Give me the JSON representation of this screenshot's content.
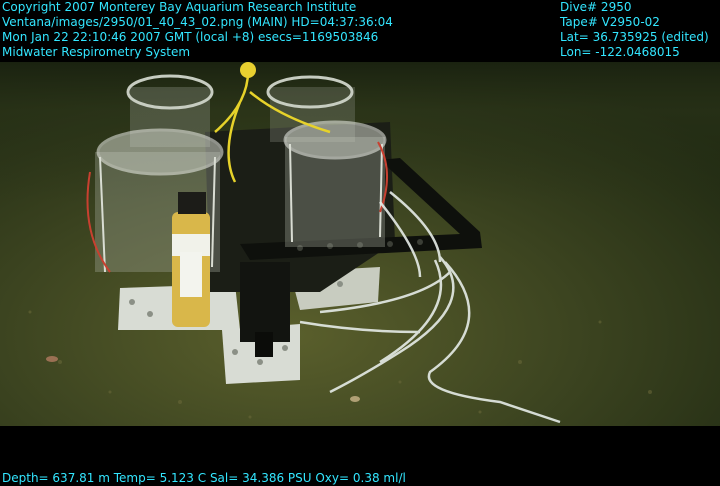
{
  "overlay": {
    "top_left": [
      "Copyright 2007 Monterey Bay Aquarium Research Institute",
      "Ventana/images/2950/01_40_43_02.png (MAIN)  HD=04:37:36:04",
      "Mon Jan 22 22:10:46 2007 GMT (local +8)  esecs=1169503846",
      "Midwater Respirometry System"
    ],
    "top_right": [
      "Dive# 2950",
      "Tape# V2950-02",
      "Lat= 36.735925 (edited)",
      "Lon= -122.0468015"
    ],
    "bottom": "Depth= 637.81 m  Temp= 5.123 C  Sal= 34.386 PSU  Oxy= 0.38 ml/l"
  },
  "colors": {
    "overlay_text": "#33e6ff",
    "seafloor": "#3a4420",
    "water": "#1f2a14",
    "letterbox": "#000000"
  }
}
